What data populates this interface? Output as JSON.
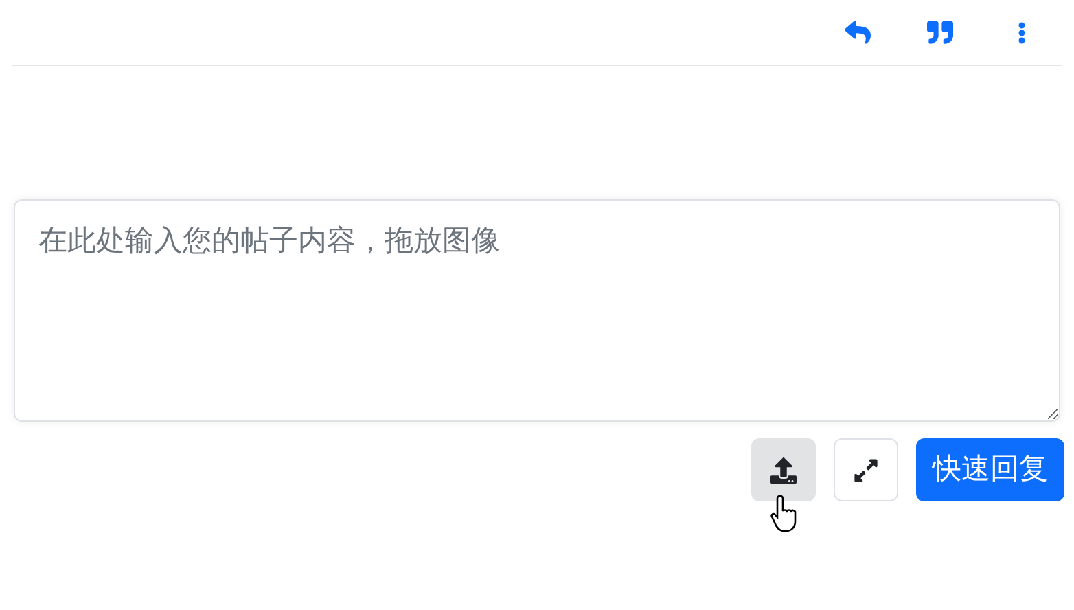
{
  "toolbar": {
    "actions": [
      {
        "kind": "reply"
      },
      {
        "kind": "quote"
      },
      {
        "kind": "more"
      }
    ]
  },
  "editor": {
    "placeholder": "在此处输入您的帖子内容，拖放图像"
  },
  "buttons": [
    {
      "kind": "upload",
      "hovered": true
    },
    {
      "kind": "expand",
      "hovered": false
    }
  ],
  "submit": {
    "label": "快速回复"
  }
}
